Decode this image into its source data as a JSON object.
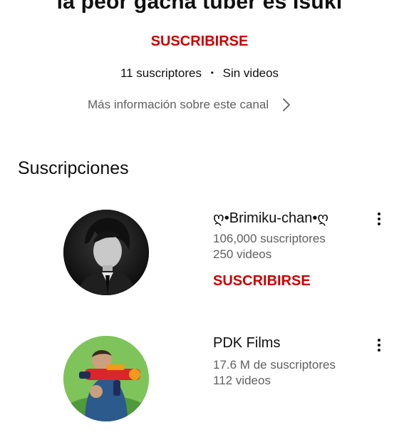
{
  "channel": {
    "title": "la peor gacha tuber es Isuki",
    "subscribe_label": "SUSCRIBIRSE",
    "subscribers": "11 suscriptores",
    "separator": "•",
    "videos": "Sin videos",
    "more_info": "Más información sobre este canal"
  },
  "subscriptions": {
    "section_title": "Suscripciones",
    "items": [
      {
        "name": "ღ•Brimiku-chan•ღ",
        "subscribers": "106,000 suscriptores",
        "videos": "250 videos",
        "subscribe_label": "SUSCRIBIRSE",
        "avatar_icon": "channel-avatar-grayscale-portrait"
      },
      {
        "name": "PDK Films",
        "subscribers": "17.6 M de suscriptores",
        "videos": "112 videos",
        "avatar_icon": "channel-avatar-nerf-blaster"
      }
    ]
  },
  "colors": {
    "accent_red": "#cc0000",
    "text_primary": "#0f0f0f",
    "text_secondary": "#606060"
  }
}
